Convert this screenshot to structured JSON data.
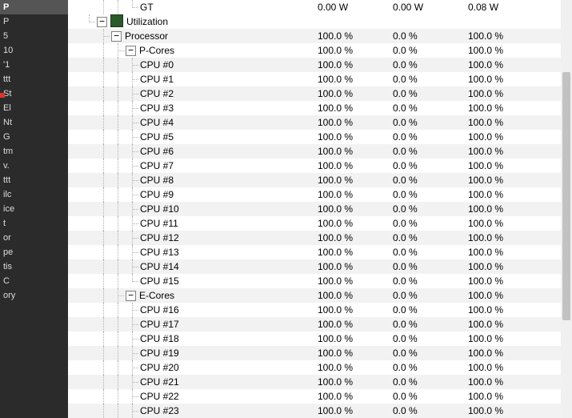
{
  "left_strip": {
    "header": "P",
    "rows": [
      "P",
      "5",
      "10",
      "'1",
      "",
      "ttt",
      "",
      "St",
      "El",
      "Nt",
      "G",
      "tm",
      "v.",
      "",
      "ttt",
      "",
      "ilc",
      "ice",
      "t",
      "or",
      "pe",
      "",
      "tis",
      "C",
      "",
      "",
      "ory"
    ]
  },
  "cols": {
    "c1": "",
    "c2": "",
    "c3": ""
  },
  "rows": [
    {
      "indent_guides": [
        "",
        "",
        "vline",
        "vline",
        "end"
      ],
      "toggle": false,
      "icon": "",
      "label": "GT",
      "v1": "0.00 W",
      "v2": "0.00 W",
      "v3": "0.08 W",
      "alt": false
    },
    {
      "indent_guides": [
        "",
        "end"
      ],
      "toggle": true,
      "icon": "chip",
      "label": "Utilization",
      "v1": "",
      "v2": "",
      "v3": "",
      "alt": false
    },
    {
      "indent_guides": [
        "",
        "",
        "tee"
      ],
      "toggle": true,
      "icon": "",
      "label": "Processor",
      "v1": "100.0 %",
      "v2": "0.0 %",
      "v3": "100.0 %",
      "alt": true
    },
    {
      "indent_guides": [
        "",
        "",
        "vline",
        "tee"
      ],
      "toggle": true,
      "icon": "",
      "label": "P-Cores",
      "v1": "100.0 %",
      "v2": "0.0 %",
      "v3": "100.0 %",
      "alt": false
    },
    {
      "indent_guides": [
        "",
        "",
        "vline",
        "vline",
        "tee"
      ],
      "toggle": false,
      "icon": "",
      "label": "CPU #0",
      "v1": "100.0 %",
      "v2": "0.0 %",
      "v3": "100.0 %",
      "alt": true
    },
    {
      "indent_guides": [
        "",
        "",
        "vline",
        "vline",
        "tee"
      ],
      "toggle": false,
      "icon": "",
      "label": "CPU #1",
      "v1": "100.0 %",
      "v2": "0.0 %",
      "v3": "100.0 %",
      "alt": false
    },
    {
      "indent_guides": [
        "",
        "",
        "vline",
        "vline",
        "tee"
      ],
      "toggle": false,
      "icon": "",
      "label": "CPU #2",
      "v1": "100.0 %",
      "v2": "0.0 %",
      "v3": "100.0 %",
      "alt": true
    },
    {
      "indent_guides": [
        "",
        "",
        "vline",
        "vline",
        "tee"
      ],
      "toggle": false,
      "icon": "",
      "label": "CPU #3",
      "v1": "100.0 %",
      "v2": "0.0 %",
      "v3": "100.0 %",
      "alt": false
    },
    {
      "indent_guides": [
        "",
        "",
        "vline",
        "vline",
        "tee"
      ],
      "toggle": false,
      "icon": "",
      "label": "CPU #4",
      "v1": "100.0 %",
      "v2": "0.0 %",
      "v3": "100.0 %",
      "alt": true
    },
    {
      "indent_guides": [
        "",
        "",
        "vline",
        "vline",
        "tee"
      ],
      "toggle": false,
      "icon": "",
      "label": "CPU #5",
      "v1": "100.0 %",
      "v2": "0.0 %",
      "v3": "100.0 %",
      "alt": false
    },
    {
      "indent_guides": [
        "",
        "",
        "vline",
        "vline",
        "tee"
      ],
      "toggle": false,
      "icon": "",
      "label": "CPU #6",
      "v1": "100.0 %",
      "v2": "0.0 %",
      "v3": "100.0 %",
      "alt": true
    },
    {
      "indent_guides": [
        "",
        "",
        "vline",
        "vline",
        "tee"
      ],
      "toggle": false,
      "icon": "",
      "label": "CPU #7",
      "v1": "100.0 %",
      "v2": "0.0 %",
      "v3": "100.0 %",
      "alt": false
    },
    {
      "indent_guides": [
        "",
        "",
        "vline",
        "vline",
        "tee"
      ],
      "toggle": false,
      "icon": "",
      "label": "CPU #8",
      "v1": "100.0 %",
      "v2": "0.0 %",
      "v3": "100.0 %",
      "alt": true
    },
    {
      "indent_guides": [
        "",
        "",
        "vline",
        "vline",
        "tee"
      ],
      "toggle": false,
      "icon": "",
      "label": "CPU #9",
      "v1": "100.0 %",
      "v2": "0.0 %",
      "v3": "100.0 %",
      "alt": false
    },
    {
      "indent_guides": [
        "",
        "",
        "vline",
        "vline",
        "tee"
      ],
      "toggle": false,
      "icon": "",
      "label": "CPU #10",
      "v1": "100.0 %",
      "v2": "0.0 %",
      "v3": "100.0 %",
      "alt": true
    },
    {
      "indent_guides": [
        "",
        "",
        "vline",
        "vline",
        "tee"
      ],
      "toggle": false,
      "icon": "",
      "label": "CPU #11",
      "v1": "100.0 %",
      "v2": "0.0 %",
      "v3": "100.0 %",
      "alt": false
    },
    {
      "indent_guides": [
        "",
        "",
        "vline",
        "vline",
        "tee"
      ],
      "toggle": false,
      "icon": "",
      "label": "CPU #12",
      "v1": "100.0 %",
      "v2": "0.0 %",
      "v3": "100.0 %",
      "alt": true
    },
    {
      "indent_guides": [
        "",
        "",
        "vline",
        "vline",
        "tee"
      ],
      "toggle": false,
      "icon": "",
      "label": "CPU #13",
      "v1": "100.0 %",
      "v2": "0.0 %",
      "v3": "100.0 %",
      "alt": false
    },
    {
      "indent_guides": [
        "",
        "",
        "vline",
        "vline",
        "tee"
      ],
      "toggle": false,
      "icon": "",
      "label": "CPU #14",
      "v1": "100.0 %",
      "v2": "0.0 %",
      "v3": "100.0 %",
      "alt": true
    },
    {
      "indent_guides": [
        "",
        "",
        "vline",
        "vline",
        "end"
      ],
      "toggle": false,
      "icon": "",
      "label": "CPU #15",
      "v1": "100.0 %",
      "v2": "0.0 %",
      "v3": "100.0 %",
      "alt": false
    },
    {
      "indent_guides": [
        "",
        "",
        "vline",
        "tee"
      ],
      "toggle": true,
      "icon": "",
      "label": "E-Cores",
      "v1": "100.0 %",
      "v2": "0.0 %",
      "v3": "100.0 %",
      "alt": true
    },
    {
      "indent_guides": [
        "",
        "",
        "vline",
        "vline",
        "tee"
      ],
      "toggle": false,
      "icon": "",
      "label": "CPU #16",
      "v1": "100.0 %",
      "v2": "0.0 %",
      "v3": "100.0 %",
      "alt": false
    },
    {
      "indent_guides": [
        "",
        "",
        "vline",
        "vline",
        "tee"
      ],
      "toggle": false,
      "icon": "",
      "label": "CPU #17",
      "v1": "100.0 %",
      "v2": "0.0 %",
      "v3": "100.0 %",
      "alt": true
    },
    {
      "indent_guides": [
        "",
        "",
        "vline",
        "vline",
        "tee"
      ],
      "toggle": false,
      "icon": "",
      "label": "CPU #18",
      "v1": "100.0 %",
      "v2": "0.0 %",
      "v3": "100.0 %",
      "alt": false
    },
    {
      "indent_guides": [
        "",
        "",
        "vline",
        "vline",
        "tee"
      ],
      "toggle": false,
      "icon": "",
      "label": "CPU #19",
      "v1": "100.0 %",
      "v2": "0.0 %",
      "v3": "100.0 %",
      "alt": true
    },
    {
      "indent_guides": [
        "",
        "",
        "vline",
        "vline",
        "tee"
      ],
      "toggle": false,
      "icon": "",
      "label": "CPU #20",
      "v1": "100.0 %",
      "v2": "0.0 %",
      "v3": "100.0 %",
      "alt": false
    },
    {
      "indent_guides": [
        "",
        "",
        "vline",
        "vline",
        "tee"
      ],
      "toggle": false,
      "icon": "",
      "label": "CPU #21",
      "v1": "100.0 %",
      "v2": "0.0 %",
      "v3": "100.0 %",
      "alt": true
    },
    {
      "indent_guides": [
        "",
        "",
        "vline",
        "vline",
        "tee"
      ],
      "toggle": false,
      "icon": "",
      "label": "CPU #22",
      "v1": "100.0 %",
      "v2": "0.0 %",
      "v3": "100.0 %",
      "alt": false
    },
    {
      "indent_guides": [
        "",
        "",
        "vline",
        "vline",
        "tee"
      ],
      "toggle": false,
      "icon": "",
      "label": "CPU #23",
      "v1": "100.0 %",
      "v2": "0.0 %",
      "v3": "100.0 %",
      "alt": true
    }
  ]
}
